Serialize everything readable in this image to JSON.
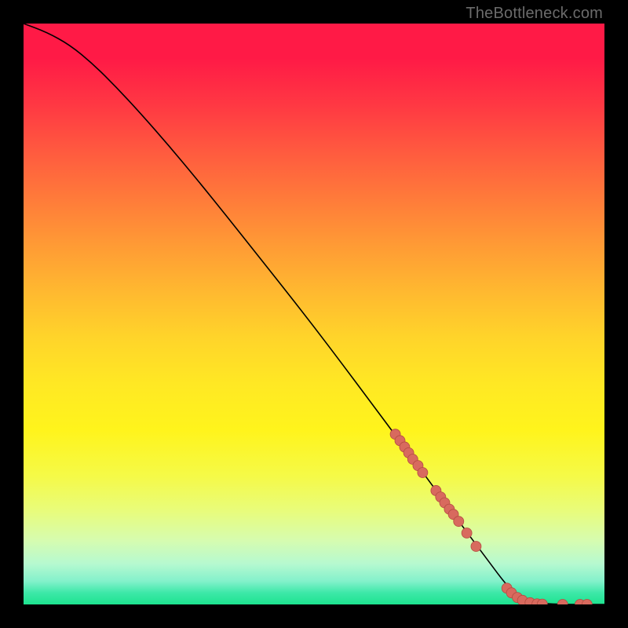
{
  "watermark": "TheBottleneck.com",
  "colors": {
    "curve": "#000000",
    "marker_fill": "#d86a5e",
    "marker_stroke": "#b54c42"
  },
  "chart_data": {
    "type": "line",
    "title": "",
    "xlabel": "",
    "ylabel": "",
    "xlim": [
      0,
      100
    ],
    "ylim": [
      0,
      100
    ],
    "grid": false,
    "curve": [
      {
        "x": 0,
        "y": 100
      },
      {
        "x": 4,
        "y": 98.5
      },
      {
        "x": 8,
        "y": 96.3
      },
      {
        "x": 12,
        "y": 93.0
      },
      {
        "x": 16,
        "y": 89.0
      },
      {
        "x": 20,
        "y": 84.7
      },
      {
        "x": 25,
        "y": 79.0
      },
      {
        "x": 30,
        "y": 73.0
      },
      {
        "x": 35,
        "y": 66.8
      },
      {
        "x": 40,
        "y": 60.5
      },
      {
        "x": 45,
        "y": 54.2
      },
      {
        "x": 50,
        "y": 47.8
      },
      {
        "x": 55,
        "y": 41.2
      },
      {
        "x": 60,
        "y": 34.5
      },
      {
        "x": 65,
        "y": 27.8
      },
      {
        "x": 70,
        "y": 21.0
      },
      {
        "x": 75,
        "y": 14.2
      },
      {
        "x": 80,
        "y": 7.5
      },
      {
        "x": 83,
        "y": 3.5
      },
      {
        "x": 85,
        "y": 1.5
      },
      {
        "x": 88,
        "y": 0.3
      },
      {
        "x": 92,
        "y": 0.0
      },
      {
        "x": 100,
        "y": 0.0
      }
    ],
    "markers": [
      {
        "x": 64.0,
        "y": 29.3
      },
      {
        "x": 64.8,
        "y": 28.2
      },
      {
        "x": 65.6,
        "y": 27.1
      },
      {
        "x": 66.3,
        "y": 26.1
      },
      {
        "x": 67.0,
        "y": 25.0
      },
      {
        "x": 67.9,
        "y": 23.9
      },
      {
        "x": 68.7,
        "y": 22.7
      },
      {
        "x": 71.0,
        "y": 19.6
      },
      {
        "x": 71.8,
        "y": 18.5
      },
      {
        "x": 72.5,
        "y": 17.5
      },
      {
        "x": 73.3,
        "y": 16.4
      },
      {
        "x": 74.0,
        "y": 15.5
      },
      {
        "x": 74.9,
        "y": 14.3
      },
      {
        "x": 76.3,
        "y": 12.3
      },
      {
        "x": 77.9,
        "y": 10.0
      },
      {
        "x": 83.2,
        "y": 2.8
      },
      {
        "x": 84.0,
        "y": 2.0
      },
      {
        "x": 85.0,
        "y": 1.2
      },
      {
        "x": 85.9,
        "y": 0.7
      },
      {
        "x": 87.2,
        "y": 0.3
      },
      {
        "x": 88.4,
        "y": 0.1
      },
      {
        "x": 89.3,
        "y": 0.05
      },
      {
        "x": 92.8,
        "y": 0.0
      },
      {
        "x": 95.8,
        "y": 0.0
      },
      {
        "x": 97.0,
        "y": 0.0
      }
    ]
  }
}
